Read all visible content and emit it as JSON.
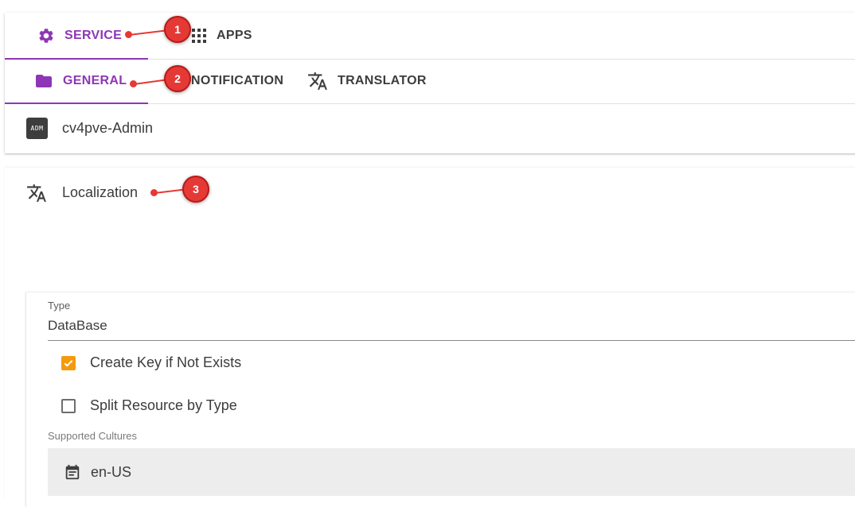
{
  "tabs_top": [
    {
      "label": "SERVICE",
      "icon": "gear-icon",
      "active": true
    },
    {
      "label": "APPS",
      "icon": "apps-grid-icon",
      "active": false
    }
  ],
  "tabs_sub": [
    {
      "label": "GENERAL",
      "icon": "folder-icon",
      "active": true
    },
    {
      "label": "NOTIFICATION",
      "icon": "bell-icon",
      "active": false
    },
    {
      "label": "TRANSLATOR",
      "icon": "translate-icon",
      "active": false
    }
  ],
  "identity": {
    "badge": "ADM",
    "name": "cv4pve-Admin"
  },
  "localization": {
    "title": "Localization",
    "type_label": "Type",
    "type_value": "DataBase",
    "create_key_label": "Create Key if Not Exists",
    "create_key_checked": true,
    "split_resource_label": "Split Resource by Type",
    "split_resource_checked": false,
    "supported_cultures_label": "Supported Cultures",
    "cultures": [
      "en-US"
    ]
  },
  "markers": [
    "1",
    "2",
    "3"
  ],
  "colors": {
    "accent": "#8e36b6",
    "checkbox": "#f59a0c",
    "marker": "#e53935"
  }
}
